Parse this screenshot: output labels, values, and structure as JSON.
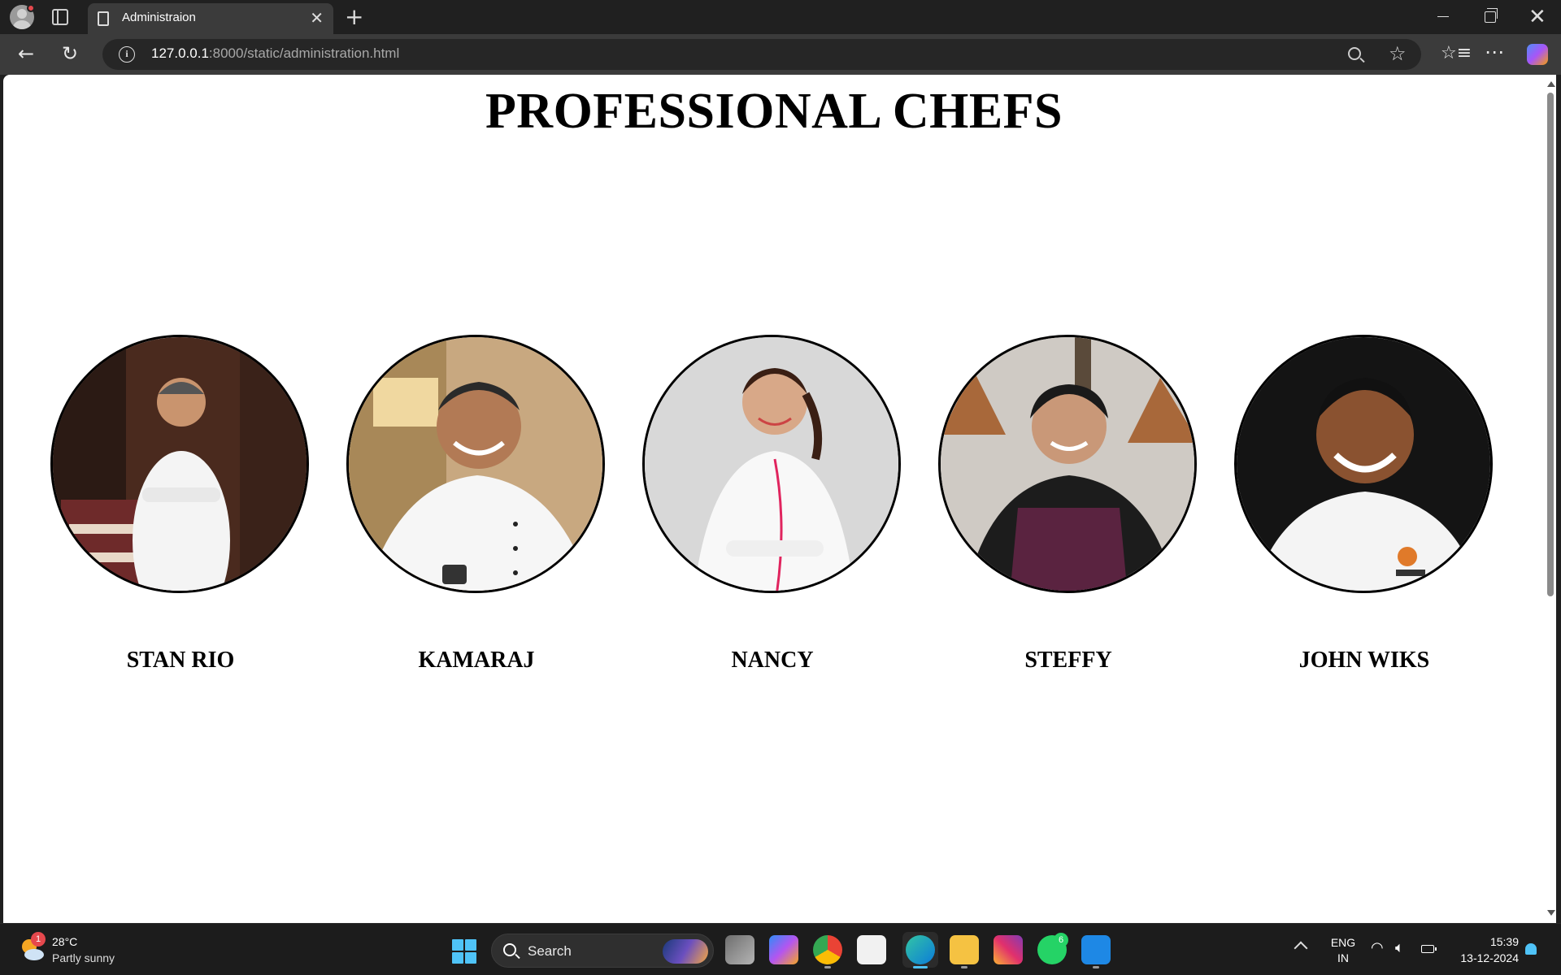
{
  "browser": {
    "tab_title": "Administraion",
    "url_host": "127.0.0.1",
    "url_rest": ":8000/static/administration.html"
  },
  "page": {
    "title": "PROFESSIONAL CHEFS",
    "chefs": [
      {
        "name": "STAN RIO"
      },
      {
        "name": "KAMARAJ"
      },
      {
        "name": "NANCY"
      },
      {
        "name": "STEFFY"
      },
      {
        "name": "JOHN WIKS"
      }
    ]
  },
  "taskbar": {
    "weather_badge": "1",
    "temperature": "28°C",
    "weather": "Partly sunny",
    "search_label": "Search",
    "whatsapp_badge": "6",
    "lang_line1": "ENG",
    "lang_line2": "IN",
    "time": "15:39",
    "date": "13-12-2024"
  }
}
